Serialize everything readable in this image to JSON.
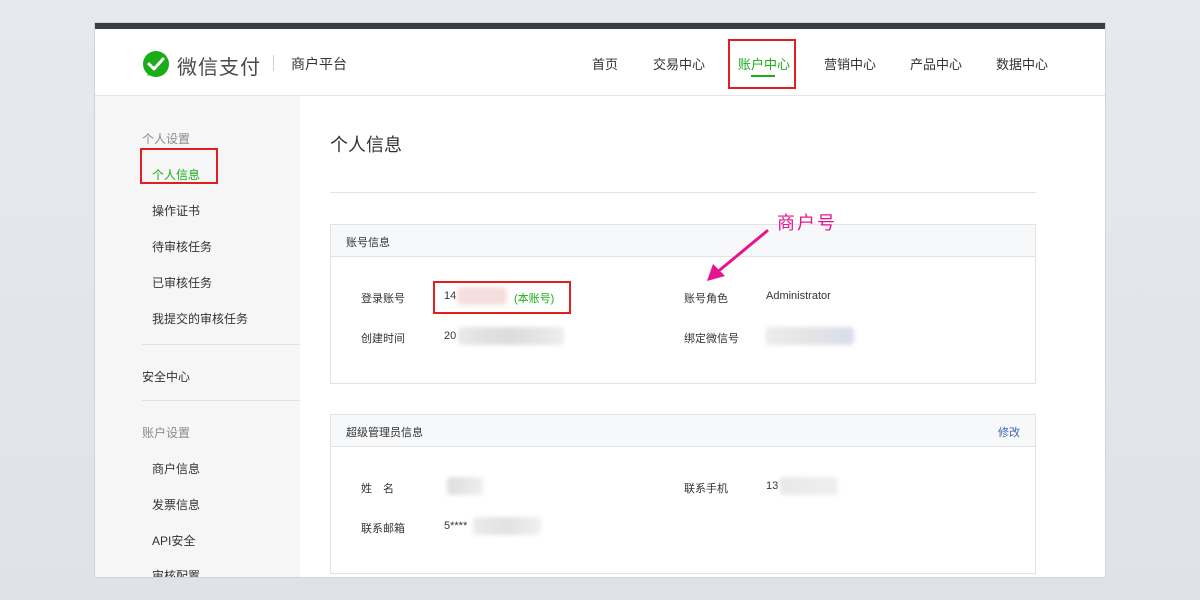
{
  "brand": {
    "name": "微信支付",
    "platform": "商户平台"
  },
  "nav": [
    {
      "label": "首页"
    },
    {
      "label": "交易中心"
    },
    {
      "label": "账户中心"
    },
    {
      "label": "营销中心"
    },
    {
      "label": "产品中心"
    },
    {
      "label": "数据中心"
    }
  ],
  "nav_active": "账户中心",
  "sidebar": {
    "group_personal": "个人设置",
    "personal_items": [
      "个人信息",
      "操作证书",
      "待审核任务",
      "已审核任务",
      "我提交的审核任务"
    ],
    "security": "安全中心",
    "group_account": "账户设置",
    "account_items": [
      "商户信息",
      "发票信息",
      "API安全",
      "审核配置"
    ]
  },
  "main": {
    "title": "个人信息",
    "account_panel": {
      "title": "账号信息",
      "login_label": "登录账号",
      "login_value_prefix": "14",
      "login_suffix": "(本账号)",
      "created_label": "创建时间",
      "created_value_prefix": "20",
      "role_label": "账号角色",
      "role_value": "Administrator",
      "wechat_label": "绑定微信号"
    },
    "admin_panel": {
      "title": "超级管理员信息",
      "edit": "修改",
      "name_label": "姓　名",
      "phone_label": "联系手机",
      "phone_value_prefix": "13",
      "email_label": "联系邮箱",
      "email_value_prefix": "5****"
    }
  },
  "annotation": {
    "text": "商户号"
  },
  "colors": {
    "accent": "#1aad19",
    "highlight": "#e02020",
    "annotation": "#e6148f",
    "link": "#3b62b5"
  }
}
